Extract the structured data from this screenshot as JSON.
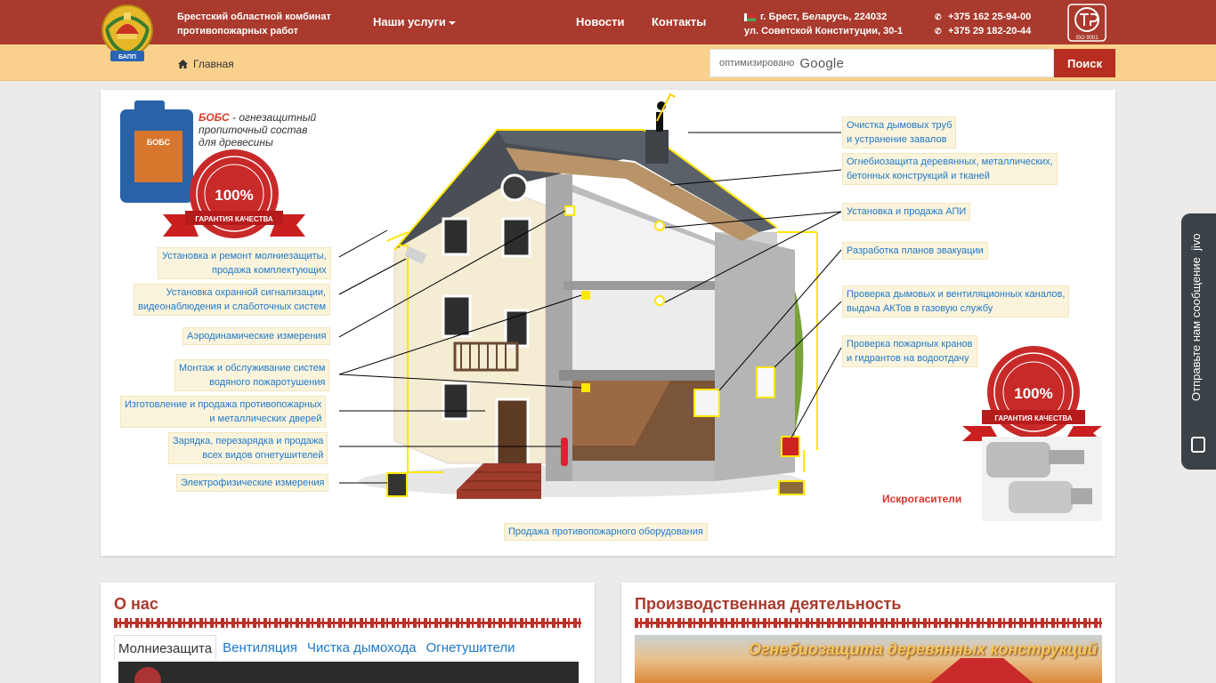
{
  "header": {
    "company": [
      "Брестский областной комбинат",
      "противопожарных работ"
    ],
    "nav": {
      "services": "Наши услуги",
      "news": "Новости",
      "contacts": "Контакты"
    },
    "address": [
      "г. Брест, Беларусь, 224032",
      "ул. Советской Конституции, 30-1"
    ],
    "phones": [
      "+375 162 25-94-00",
      "+375 29 182-20-44"
    ],
    "logo_text": "БАПП",
    "iso_text": "ISO 9001"
  },
  "subbar": {
    "breadcrumb": "Главная",
    "search_hint": "оптимизировано",
    "search_brand": "Google",
    "search_button": "Поиск"
  },
  "hero": {
    "bobs_name": "БОБС",
    "bobs_desc": [
      "- огнезащитный",
      "пропиточный состав",
      "для древесины"
    ],
    "seal_top": "СОБСТВЕННОЕ ПРОИЗВОДСТВО",
    "seal_percent": "100%",
    "seal_ribbon": "ГАРАНТИЯ КАЧЕСТВА",
    "left_labels": [
      [
        "Установка и ремонт молниезащиты,",
        "продажа комплектующих"
      ],
      [
        "Установка охранной сигнализации,",
        "видеонаблюдения и слаботочных систем"
      ],
      [
        "Аэродинамические измерения"
      ],
      [
        "Монтаж и обслуживание систем",
        "водяного пожаротушения"
      ],
      [
        "Изготовление и продажа противопожарных",
        "и металлических дверей"
      ],
      [
        "Зарядка, перезарядка и продажа",
        "всех видов огнетушителей"
      ],
      [
        "Электрофизические измерения"
      ]
    ],
    "right_labels": [
      [
        "Очистка дымовых труб",
        "и устранение завалов"
      ],
      [
        "Огнебиозащита деревянных, металлических,",
        "бетонных конструкций и тканей"
      ],
      [
        "Установка и продажа АПИ"
      ],
      [
        "Разработка планов эвакуации"
      ],
      [
        "Проверка дымовых и вентиляционных каналов,",
        "выдача АКТов в газовую службу"
      ],
      [
        "Проверка пожарных кранов",
        "и гидрантов на водоотдачу"
      ]
    ],
    "bottom_label": "Продажа противопожарного оборудования",
    "iskro": "Искрогасители",
    "drum_label": "БОБС"
  },
  "jivo": {
    "text": "Отправьте нам сообщение",
    "brand": "jivo"
  },
  "about": {
    "title": "О нас",
    "tabs": [
      "Молниезащита",
      "Вентиляция",
      "Чистка дымохода",
      "Огнетушители"
    ]
  },
  "production": {
    "title": "Производственная деятельность",
    "caption": "Огнебиозащита деревянных конструкций"
  },
  "colors": {
    "header_red": "#a93a2d",
    "subbar_yellow": "#f9d18c",
    "link_blue": "#1e78c8",
    "label_bg": "#fbf4dc"
  }
}
